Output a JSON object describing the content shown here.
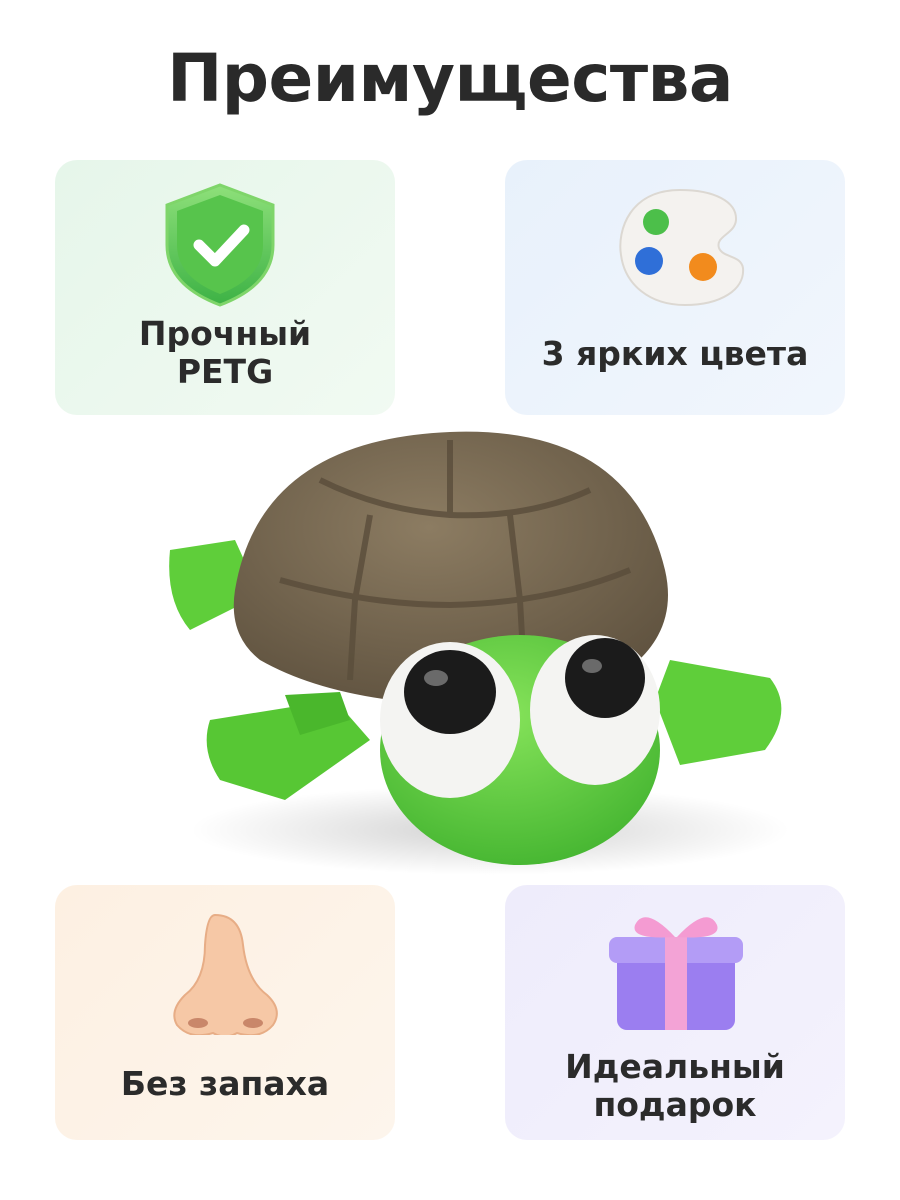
{
  "page": {
    "title": "Преимущества"
  },
  "features": [
    {
      "label_line1": "Прочный",
      "label_line2": "PETG",
      "icon": "shield-check-icon",
      "bg": "#e6f6ea"
    },
    {
      "label_line1": "3 ярких цвета",
      "icon": "paint-palette-icon",
      "bg": "#e8f1fb"
    },
    {
      "label_line1": "Без запаха",
      "icon": "nose-icon",
      "bg": "#fdf0e2"
    },
    {
      "label_line1": "Идеальный",
      "label_line2": "подарок",
      "icon": "gift-box-icon",
      "bg": "#eeecfb"
    }
  ],
  "colors": {
    "turtle_body": "#5fce3a",
    "turtle_shell": "#7a6b53",
    "title_text": "#2a2a2a"
  }
}
